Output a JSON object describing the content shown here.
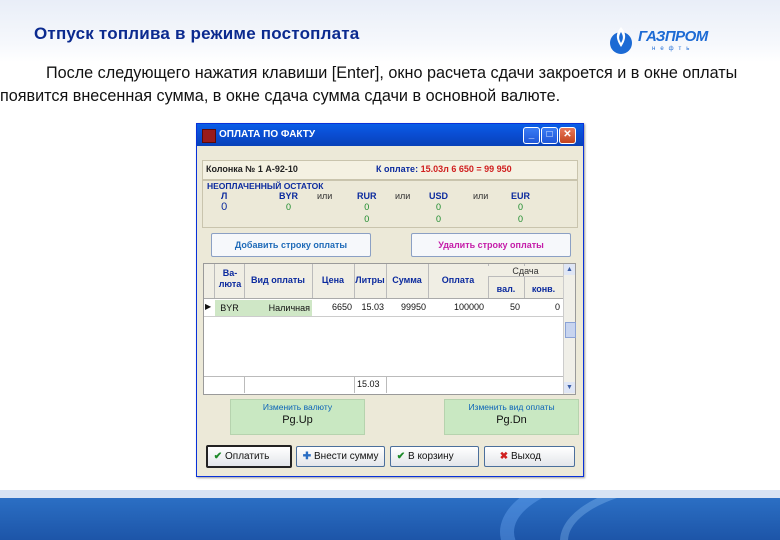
{
  "slide": {
    "title": "Отпуск топлива в режиме постоплата",
    "logo_main": "ГАЗПРОМ",
    "logo_sub": "нефть",
    "description_line1": "После следующего нажатия клавиши [Enter], окно расчета сдачи закроется и в окне оплаты",
    "description_line2": "появится внесенная сумма, в окне сдача сумма сдачи в основной валюте."
  },
  "window": {
    "title": "ОПЛАТА ПО ФАКТУ",
    "controls": {
      "minimize": "_",
      "maximize": "□",
      "close": "✕"
    },
    "column_info": "Колонка № 1 А-92-10",
    "to_pay_label": "К оплате:",
    "to_pay_value": "15.03л  6 650 =  99 950",
    "remainder_title": "НЕОПЛАЧЕННЫЙ ОСТАТОК",
    "or_label": "или",
    "remainder": [
      {
        "header": "Л",
        "values": [
          "0"
        ]
      },
      {
        "header": "BYR",
        "values": [
          "0"
        ]
      },
      {
        "header": "RUR",
        "values": [
          "0",
          "0"
        ]
      },
      {
        "header": "USD",
        "values": [
          "0",
          "0"
        ]
      },
      {
        "header": "EUR",
        "values": [
          "0",
          "0"
        ]
      }
    ],
    "add_row_button": "Добавить строку оплаты",
    "delete_row_button": "Удалить строку оплаты",
    "grid": {
      "headers": {
        "currency": "Ва-\nлюта",
        "payment_type": "Вид оплаты",
        "price": "Цена",
        "liters": "Литры",
        "sum": "Сумма",
        "payment": "Оплата",
        "change": "Сдача",
        "change_currency": "вал.",
        "change_final": "конв."
      },
      "row": {
        "marker": "▶",
        "currency": "BYR",
        "payment_type": "Наличная",
        "price": "6650",
        "liters": "15.03",
        "sum": "99950",
        "payment": "100000",
        "change_currency": "50",
        "change_final": "0"
      },
      "footer_liters": "15.03"
    },
    "change_currency_hint": "Изменить валюту",
    "change_currency_key": "Pg.Up",
    "change_payment_hint": "Изменить вид оплаты",
    "change_payment_key": "Pg.Dn",
    "buttons": {
      "pay": "Оплатить",
      "enter_sum": "Внести сумму",
      "to_cart": "В корзину",
      "exit": "Выход"
    }
  },
  "colors": {
    "title_blue": "#0b2a8f",
    "xp_titlebar": "#0a4fd6",
    "key_green": "#c9e8c2",
    "red_value": "#d02020"
  }
}
